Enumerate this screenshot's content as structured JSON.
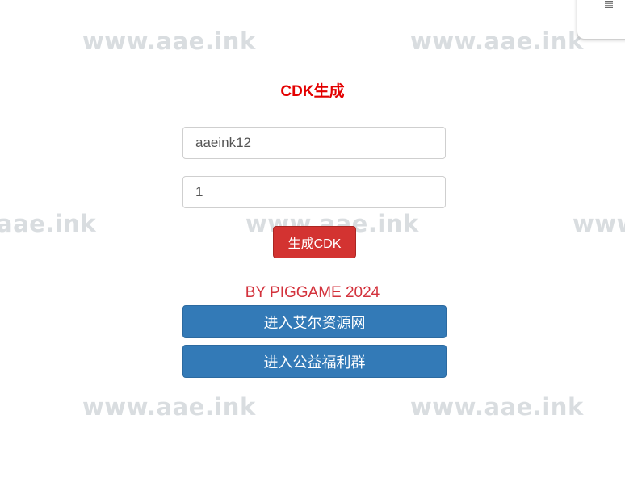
{
  "watermark": {
    "text": "www.aae.ink",
    "partial_left": "aae.ink",
    "partial_right": "www"
  },
  "page": {
    "title": "CDK生成",
    "title_color": "#e30000"
  },
  "form": {
    "name_value": "aaeink12",
    "count_value": "1",
    "generate_label": "生成CDK"
  },
  "footer": {
    "byline": "BY PIGGAME 2024",
    "resource_site_label": "进入艾尔资源网",
    "welfare_group_label": "进入公益福利群"
  },
  "colors": {
    "danger": "#d33331",
    "primary": "#337ab7",
    "byline": "#d3323c"
  },
  "icons": {
    "corner": "document-icon"
  }
}
